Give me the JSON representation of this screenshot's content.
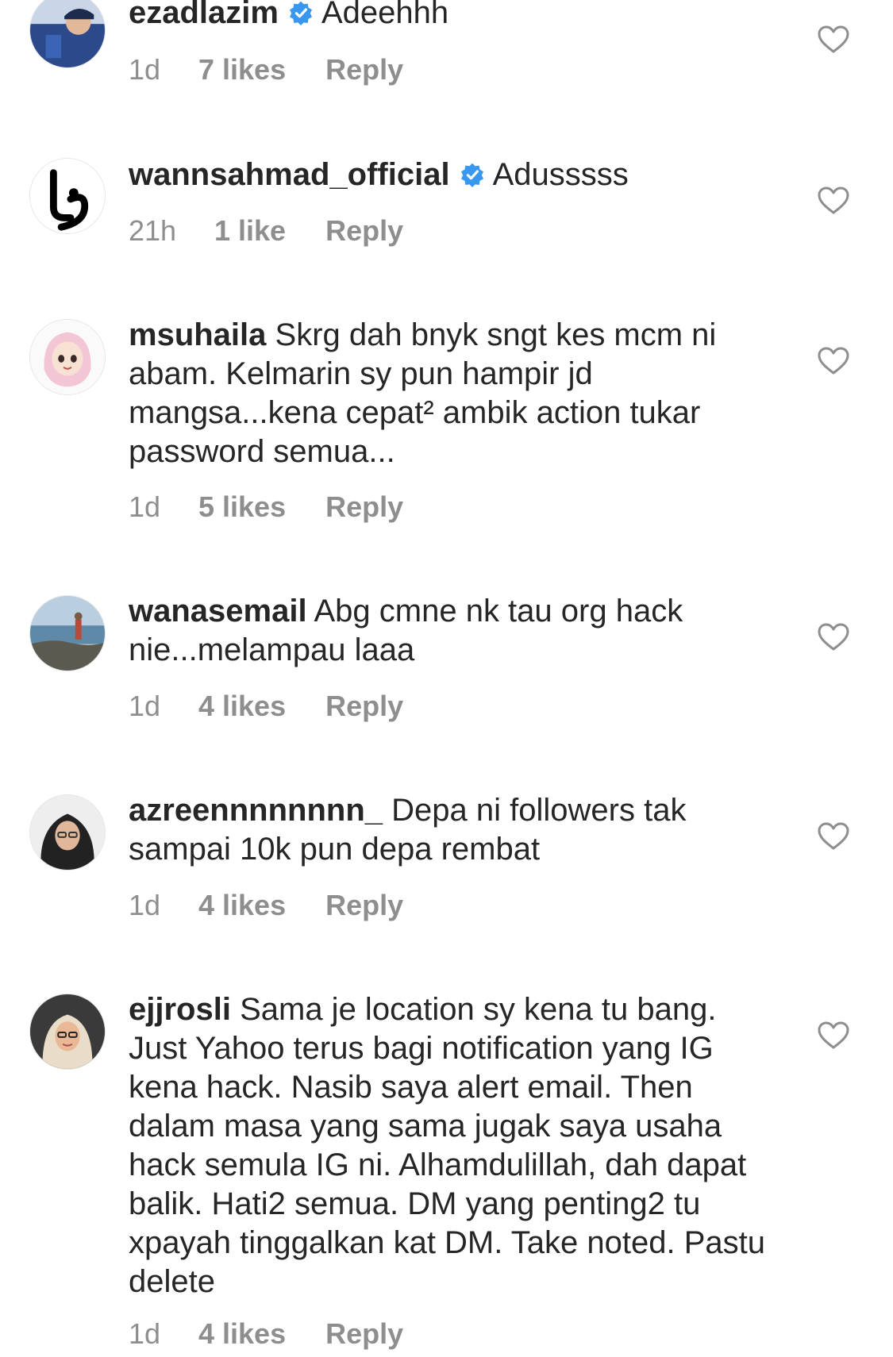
{
  "comments": [
    {
      "username": "ezadlazim",
      "verified": true,
      "text": "Adeehhh",
      "time": "1d",
      "likes": "7 likes",
      "reply": "Reply",
      "avatar": "man-in-cap-avatar"
    },
    {
      "username": "wannsahmad_official",
      "verified": true,
      "text": "Adusssss",
      "time": "21h",
      "likes": "1 like",
      "reply": "Reply",
      "avatar": "logo-avatar"
    },
    {
      "username": "msuhaila",
      "verified": false,
      "text": "Skrg dah bnyk sngt kes mcm ni abam. Kelmarin sy pun hampir jd mangsa...kena cepat² ambik action tukar password semua...",
      "time": "1d",
      "likes": "5 likes",
      "reply": "Reply",
      "avatar": "hijab-cartoon-avatar"
    },
    {
      "username": "wanasemail",
      "verified": false,
      "text": "Abg cmne nk tau org hack nie...melampau laaa",
      "time": "1d",
      "likes": "4 likes",
      "reply": "Reply",
      "avatar": "beach-photo-avatar"
    },
    {
      "username": "azreennnnnnnn_",
      "verified": false,
      "text": "Depa ni followers tak sampai 10k pun depa rembat",
      "time": "1d",
      "likes": "4 likes",
      "reply": "Reply",
      "avatar": "woman-hijab-avatar"
    },
    {
      "username": "ejjrosli",
      "verified": false,
      "text": "Sama je location sy kena tu bang. Just Yahoo terus bagi notification yang IG kena hack. Nasib saya alert email. Then dalam masa yang sama jugak saya usaha hack semula IG ni. Alhamdulillah, dah dapat balik. Hati2 semua. DM yang penting2 tu xpayah tinggalkan kat DM. Take noted. Pastu delete",
      "time": "1d",
      "likes": "4 likes",
      "reply": "Reply",
      "avatar": "woman-glasses-avatar"
    }
  ],
  "colors": {
    "text": "#262626",
    "meta": "#8e8e8e",
    "verified_badge": "#3897f0",
    "heart_outline": "#8e8e8e"
  },
  "icons": {
    "like": "heart-outline-icon",
    "verified": "verified-badge-icon"
  }
}
